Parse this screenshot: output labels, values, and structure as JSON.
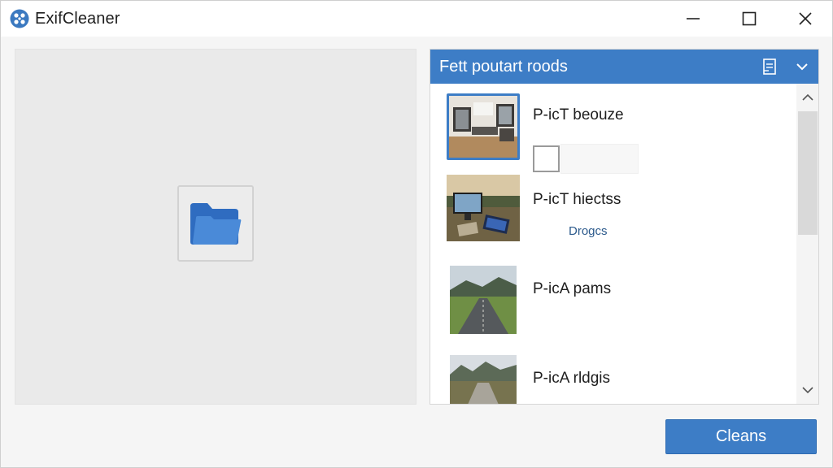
{
  "window": {
    "title": "ExifCleaner",
    "controls": {
      "minimize": "minimize-icon",
      "maximize": "maximize-icon",
      "close": "close-icon"
    }
  },
  "dropzone": {
    "icon": "folder-icon"
  },
  "panel": {
    "title": "Fett poutart roods",
    "icons": [
      "document-icon",
      "chevron-down-icon"
    ],
    "items": [
      {
        "title": "P-icT beouze",
        "subtitle": "",
        "selected": true,
        "thumb": "room-photo"
      },
      {
        "title": "P-icT hiectss",
        "subtitle": "Drogcs",
        "selected": false,
        "thumb": "monitor-photo"
      },
      {
        "title": "P-icA pams",
        "subtitle": "",
        "selected": false,
        "thumb": "road-photo"
      },
      {
        "title": "P-icA rldgis",
        "subtitle": "",
        "selected": false,
        "thumb": "mountain-road-photo"
      }
    ]
  },
  "actions": {
    "clean_label": "Cleans"
  },
  "colors": {
    "accent": "#3d7dc6",
    "window_bg": "#f5f5f5",
    "dropzone_bg": "#eaeaea"
  }
}
